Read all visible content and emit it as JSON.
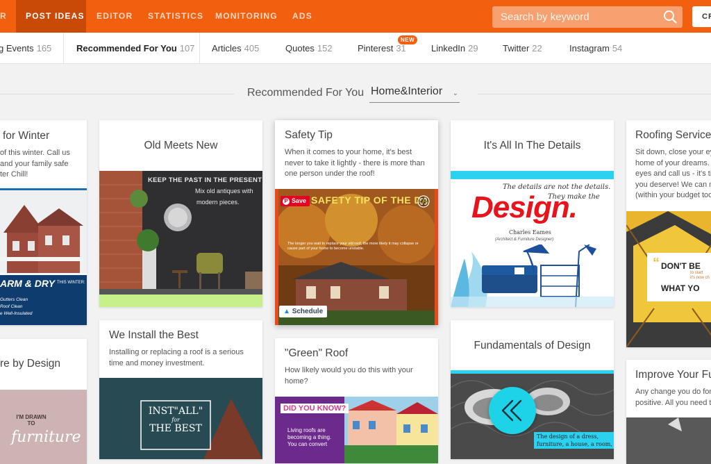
{
  "topnav": {
    "items": [
      "R",
      "POST IDEAS",
      "EDITOR",
      "STATISTICS",
      "MONITORING",
      "ADS"
    ],
    "active": "POST IDEAS",
    "search_placeholder": "Search by keyword",
    "create_label": "CR"
  },
  "tabs": [
    {
      "label": "g Events",
      "count": "165"
    },
    {
      "label": "Recommended For You",
      "count": "107"
    },
    {
      "label": "Articles",
      "count": "405"
    },
    {
      "label": "Quotes",
      "count": "152"
    },
    {
      "label": "Pinterest",
      "count": "31"
    },
    {
      "label": "LinkedIn",
      "count": "29"
    },
    {
      "label": "Twitter",
      "count": "22"
    },
    {
      "label": "Instagram",
      "count": "54"
    }
  ],
  "new_badge": "NEW",
  "filter": {
    "label": "Recommended For You",
    "selected": "Home&Interior"
  },
  "cards": {
    "winter": {
      "title": "for Winter",
      "text": [
        "of this winter. Call us",
        "and your family safe",
        "ter Chill!"
      ],
      "overlay_big": "ARM & DRY",
      "overlay_small": "THIS WINTER:",
      "overlay_lines": [
        "Gutters Clean",
        "Roof Clean",
        "e Well-Insulated"
      ]
    },
    "old_meets_new": {
      "title": "Old Meets New",
      "overlay_lines": [
        "KEEP THE PAST IN THE PRESENT TENSE.",
        "Mix old antiques with",
        "modern pieces."
      ]
    },
    "safety": {
      "title": "Safety Tip",
      "text": [
        "When it comes to your home, it's best",
        "never to take it lightly - there is more than",
        "one person under the roof!"
      ],
      "save_label": "Save",
      "overlay_big": "SAFETY TIP OF THE DA",
      "overlay_small": "The longer you wait to replace your old roof, the more likely it may collapse or cause part of your home to become unstable.",
      "schedule_label": "Schedule"
    },
    "details": {
      "title": "It's All In The Details",
      "quote_top": "The details are not the details.",
      "quote_big": "Design.",
      "quote_after": "They make the",
      "author": "Charles Eames",
      "author_sub": "(Architect & Furniture Designer)"
    },
    "roofing": {
      "title": "Roofing Service",
      "text": [
        "Sit down, close your ey",
        "home of your dreams. I",
        "eyes and call us - it's ti",
        "you deserve! We can m",
        "(within your budget too"
      ],
      "overlay_lines": [
        "DON'T BE",
        "WHAT YO",
        "to start",
        "it's now ch"
      ]
    },
    "furniture": {
      "title": "re by Design",
      "overlay_lines": [
        "I'M DRAWN",
        "TO",
        "furniture"
      ]
    },
    "install": {
      "title": "We Install the Best",
      "text": [
        "Installing or replacing a roof is a serious",
        "time and money investment."
      ],
      "overlay_lines": [
        "INST\"ALL\"",
        "for",
        "THE BEST"
      ]
    },
    "green_roof": {
      "title": "\"Green\" Roof",
      "text": [
        "How likely would you do this with your",
        "home?"
      ],
      "overlay_big": "DID YOU KNOW?",
      "overlay_lines": [
        "Living roofs are",
        "becoming a thing.",
        "You can convert"
      ]
    },
    "fundamentals": {
      "title": "Fundamentals of Design",
      "overlay_lines": [
        "The design of a dress,",
        "furniture, a house, a room,"
      ]
    },
    "improve": {
      "title": "Improve Your Fu",
      "text": [
        "Any change you do for",
        "positive. All you need t"
      ]
    }
  },
  "colors": {
    "brand": "#f25f0f",
    "active_nav": "#c94a06",
    "cyan": "#2dd1f0"
  }
}
